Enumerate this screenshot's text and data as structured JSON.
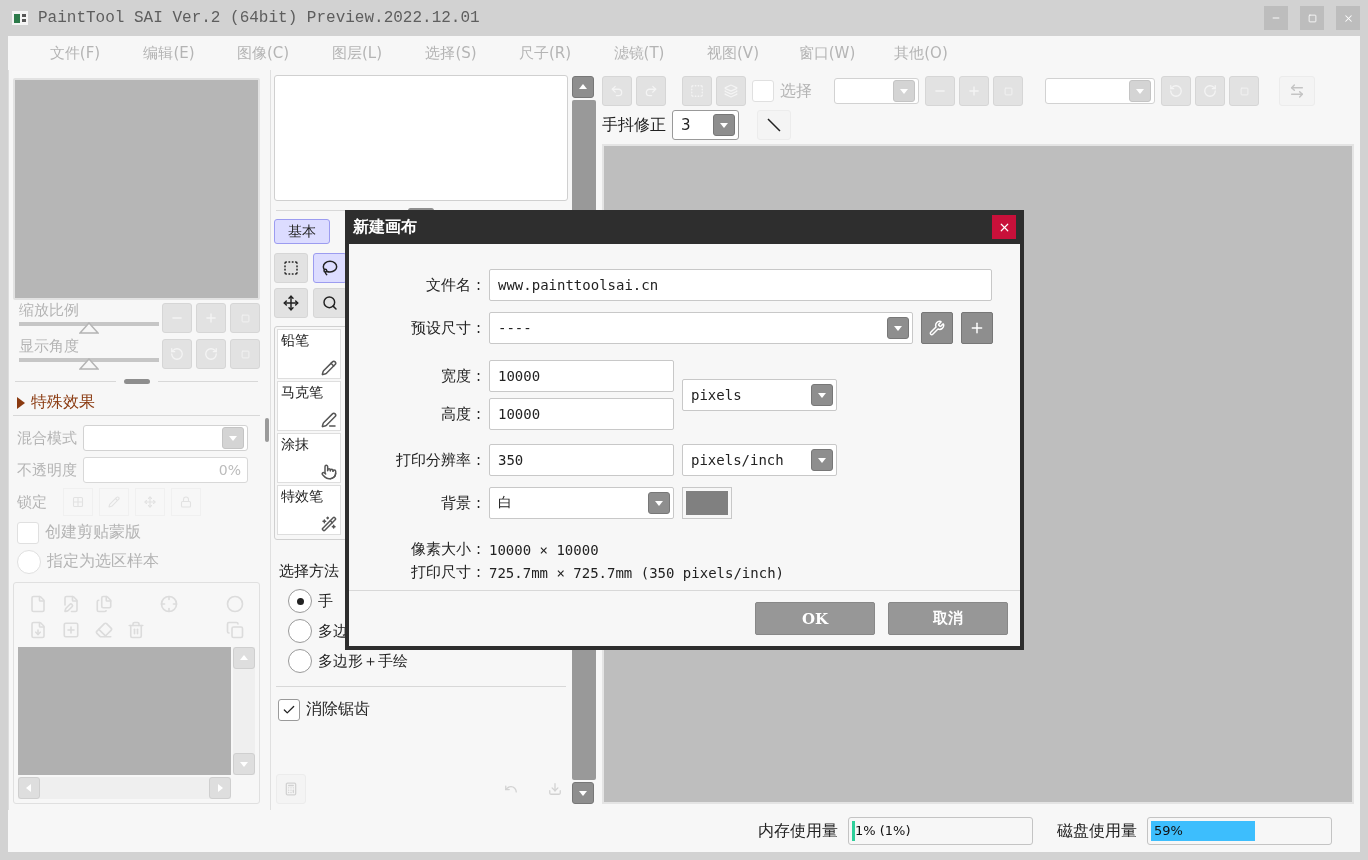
{
  "window": {
    "title": "PaintTool SAI Ver.2 (64bit) Preview.2022.12.01"
  },
  "menu": [
    {
      "label": "文件(F)"
    },
    {
      "label": "编辑(E)"
    },
    {
      "label": "图像(C)"
    },
    {
      "label": "图层(L)"
    },
    {
      "label": "选择(S)"
    },
    {
      "label": "尺子(R)"
    },
    {
      "label": "滤镜(T)"
    },
    {
      "label": "视图(V)"
    },
    {
      "label": "窗口(W)"
    },
    {
      "label": "其他(O)"
    }
  ],
  "navigator": {
    "zoom": {
      "label": "缩放比例",
      "level": 0.5
    },
    "angle": {
      "label": "显示角度",
      "level": 0.5
    }
  },
  "effects": {
    "label": "特殊效果",
    "expanded": false
  },
  "layer_props": {
    "blend_label": "混合模式",
    "opacity_label": "不透明度",
    "opacity_value": "0%",
    "lock_label": "锁定",
    "clip": {
      "label": "创建剪贴蒙版",
      "checked": false
    },
    "selection_source": {
      "label": "指定为选区样本",
      "selected": false
    }
  },
  "tool_tabs": [
    {
      "label": "基本",
      "selected": true
    }
  ],
  "select_tools": [
    {
      "kind": "rect",
      "selected": false
    },
    {
      "kind": "lasso",
      "selected": true
    },
    {
      "kind": "move",
      "selected": false
    },
    {
      "kind": "zoom",
      "selected": false
    }
  ],
  "brushes": [
    {
      "name": "铅笔",
      "kind": "pencil"
    },
    {
      "name": "马克笔",
      "kind": "marker"
    },
    {
      "name": "涂抹",
      "kind": "smudge"
    },
    {
      "name": "特效笔",
      "kind": "sparkle"
    }
  ],
  "selection_method": {
    "label": "选择方法",
    "options": [
      {
        "label": "手",
        "selected": true
      },
      {
        "label": "多边",
        "selected": false
      },
      {
        "label": "多边形＋手绘",
        "selected": false
      }
    ]
  },
  "antialias": {
    "label": "消除锯齿",
    "checked": true
  },
  "toolbar": {
    "select_label": "选择",
    "select_checked": false,
    "stabilizer_label": "手抖修正",
    "stabilizer_value": "3"
  },
  "dialog": {
    "title": "新建画布",
    "file_label": "文件名 :",
    "file_value": "www.painttoolsai.cn",
    "preset_label": "预设尺寸 :",
    "preset_value": "----",
    "width_label": "宽度 :",
    "width_value": "10000",
    "height_label": "高度 :",
    "height_value": "10000",
    "size_unit": "pixels",
    "resolution_label": "打印分辨率 :",
    "resolution_value": "350",
    "resolution_unit": "pixels/inch",
    "background_label": "背景 :",
    "background_value": "白",
    "info": [
      {
        "label": "像素大小 :",
        "value": "10000 × 10000"
      },
      {
        "label": "打印尺寸 :",
        "value": "725.7mm × 725.7mm (350 pixels/inch)"
      }
    ],
    "buttons": [
      "OK",
      "取消"
    ]
  },
  "status": {
    "memory": {
      "label": "内存使用量",
      "reading": "1% (1%)",
      "level": 0.01
    },
    "disk": {
      "label": "磁盘使用量",
      "reading": "59%",
      "level": 0.59
    }
  }
}
